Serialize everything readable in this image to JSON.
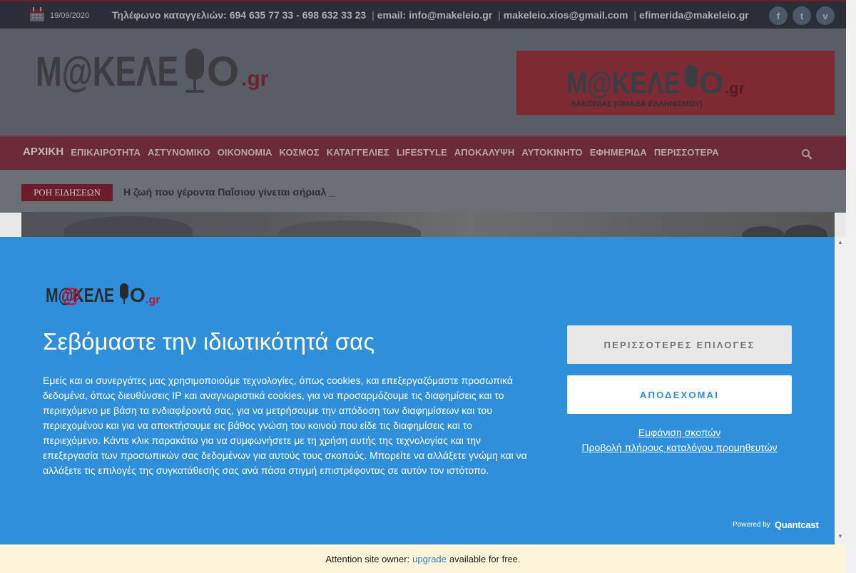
{
  "topbar": {
    "date": "19/09/2020",
    "contact_prefix": "Τηλέφωνο καταγγελιών: 694 635 77 33 - 698 632 33 23",
    "email_1": "email: info@makeleio.gr",
    "email_2": "makeleio.xios@gmail.com",
    "email_3": "efimerida@makeleio.gr",
    "separator": "|",
    "social": [
      {
        "name": "facebook",
        "glyph": "f"
      },
      {
        "name": "twitter",
        "glyph": "t"
      },
      {
        "name": "vine",
        "glyph": "v"
      }
    ]
  },
  "header": {
    "logo_text": "M@ΚΕΛΕΙΟ.gr",
    "banner_logo_text": "M@ΚΕΛΕΙΟ.gr",
    "banner_subtitle": "ΛΑΚΩΝΙΑΣ (ΟΜΑΔΑ ΕΛΛΗΝΙΣΜΟΥ)"
  },
  "nav": {
    "items": [
      "ΑΡΧΙΚΗ",
      "ΕΠΙΚΑΙΡΟΤΗΤΑ",
      "ΑΣΤΥΝΟΜΙΚΟ",
      "ΟΙΚΟΝΟΜΙΑ",
      "ΚΟΣΜΟΣ",
      "ΚΑΤΑΓΓΕΛΙΕΣ",
      "LIFESTYLE",
      "ΑΠΟΚΑΛΥΨΗ",
      "ΑΥΤΟΚΙΝΗΤΟ",
      "ΕΦΗΜΕΡΙΔΑ",
      "ΠΕΡΙΣΣΟΤΕΡΑ"
    ]
  },
  "ticker": {
    "label": "ΡΟΗ ΕΙΔΗΣΕΩΝ",
    "text": "Η ζωή που γέροντα Παΐσιου γίνεται σήριαλ _"
  },
  "consent": {
    "logo_text": "M@ΚΕΛΕΙΟ.gr",
    "title": "Σεβόμαστε την ιδιωτικότητά σας",
    "body": "Εμείς και οι συνεργάτες μας χρησιμοποιούμε τεχνολογίες, όπως cookies, και επεξεργαζόμαστε προσωπικά δεδομένα, όπως διευθύνσεις IP και αναγνωριστικά cookies, για να προσαρμόζουμε τις διαφημίσεις και το περιεχόμενο με βάση τα ενδιαφέροντά σας, για να μετρήσουμε την απόδοση των διαφημίσεων και του περιεχομένου και για να αποκτήσουμε εις βάθος γνώση του κοινού που είδε τις διαφημίσεις και το περιεχόμενο. Κάντε κλικ παρακάτω για να συμφωνήσετε με τη χρήση αυτής της τεχνολογίας και την επεξεργασία των προσωπικών σας δεδομένων για αυτούς τους σκοπούς. Μπορείτε να αλλάξετε γνώμη και να αλλάξετε τις επιλογές της συγκατάθεσής σας ανά πάσα στιγμή επιστρέφοντας σε αυτόν τον ιστότοπο.",
    "more_options_label": "ΠΕΡΙΣΣΟΤΕΡΕΣ ΕΠΙΛΟΓΕΣ",
    "accept_label": "ΑΠΟΔΕΧΟΜΑΙ",
    "purposes_link": "Εμφάνιση σκοπών",
    "vendors_link": "Προβολή πλήρους καταλόγου προμηθευτών",
    "powered_by": "Powered by",
    "powered_brand": "Quantcast"
  },
  "attention": {
    "prefix": "Attention site owner:",
    "link": "upgrade",
    "suffix": "available for free."
  },
  "colors": {
    "consent_bg": "#2f8fda",
    "topbar_bg": "#2a2f37",
    "nav_bg": "#6a2a37",
    "brand_red": "#6b1d2a",
    "attention_bg": "#fdf4d9"
  }
}
